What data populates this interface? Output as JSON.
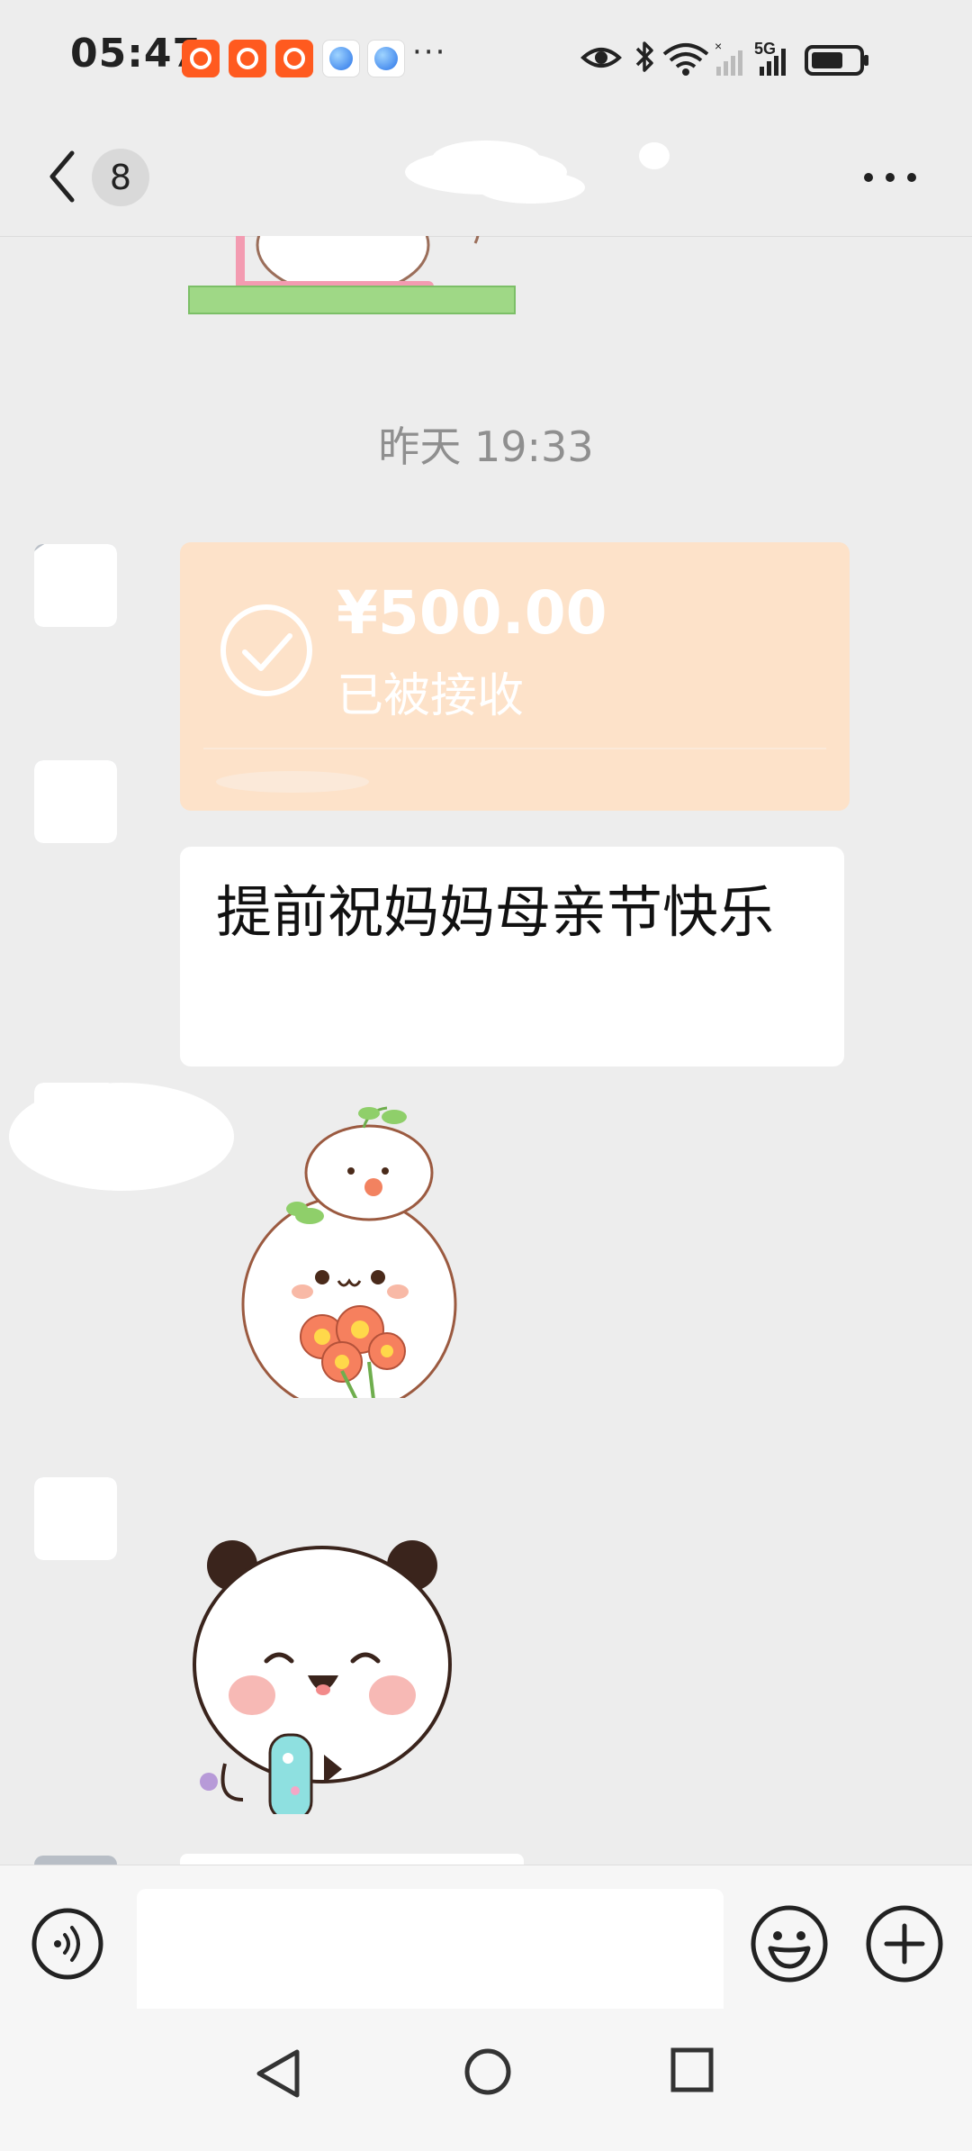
{
  "status_bar": {
    "time": "05:47",
    "more": "···",
    "icons": [
      "kuaishou-icon",
      "kuaishou-icon",
      "kuaishou-icon",
      "browser-icon",
      "browser-icon",
      "eye-icon",
      "bluetooth-icon",
      "wifi-icon",
      "signal-icon",
      "5g-signal-icon",
      "battery-icon"
    ],
    "network_label": "5G"
  },
  "header": {
    "back_icon": "chevron-left-icon",
    "unread_count": "8",
    "title_redacted": true,
    "more_icon": "more-horizontal-icon"
  },
  "chat": {
    "timestamp": "昨天 19:33",
    "messages": [
      {
        "type": "sticker",
        "name": "sticker-scooter"
      },
      {
        "type": "transfer",
        "amount": "¥500.00",
        "status": "已被接收",
        "icon": "check-circle-icon"
      },
      {
        "type": "text",
        "text": "提前祝妈妈母亲节快乐"
      },
      {
        "type": "sticker",
        "name": "sticker-flowers"
      },
      {
        "type": "sticker",
        "name": "sticker-panda"
      }
    ]
  },
  "input_bar": {
    "voice_icon": "voice-icon",
    "input_value": "",
    "emoji_icon": "emoji-icon",
    "plus_icon": "plus-icon"
  },
  "nav_bar": {
    "back": "nav-back-icon",
    "home": "nav-home-icon",
    "recent": "nav-recent-icon"
  },
  "colors": {
    "background": "#ededed",
    "transfer_card": "#fde2c9",
    "bubble": "#ffffff",
    "timestamp": "#8f8f8f"
  }
}
